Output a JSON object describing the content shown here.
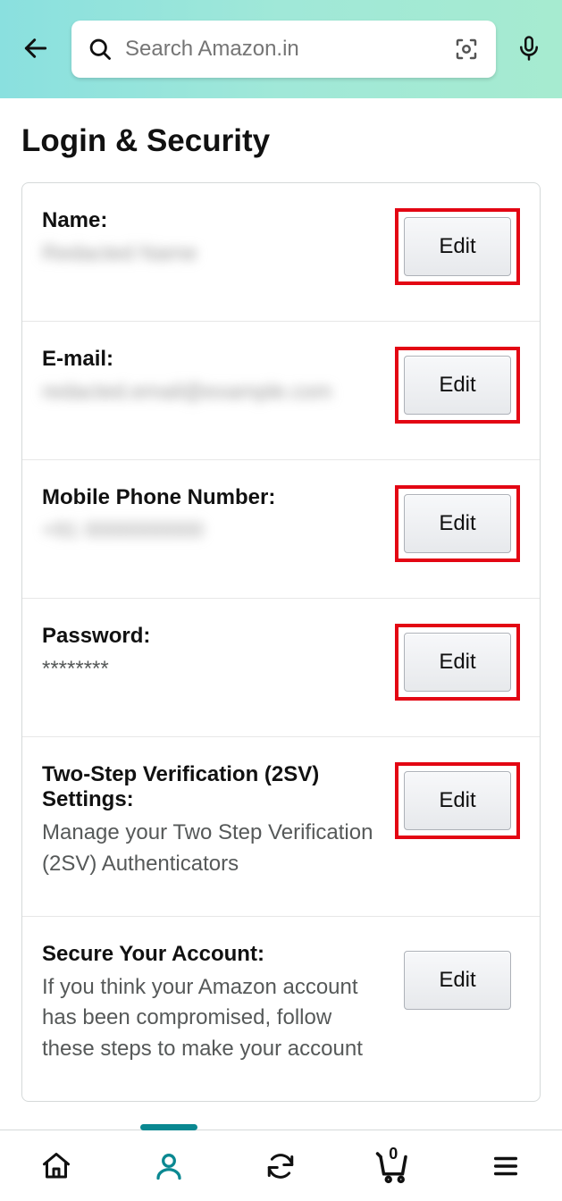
{
  "header": {
    "search_placeholder": "Search Amazon.in"
  },
  "page": {
    "title": "Login & Security"
  },
  "rows": {
    "name": {
      "label": "Name:",
      "value": "Redacted Name",
      "edit": "Edit",
      "blurred": true,
      "highlight": true
    },
    "email": {
      "label": "E-mail:",
      "value": "redacted.email@example.com",
      "edit": "Edit",
      "blurred": true,
      "highlight": true
    },
    "mobile": {
      "label": "Mobile Phone Number:",
      "value": "+91 0000000000",
      "edit": "Edit",
      "blurred": true,
      "highlight": true
    },
    "password": {
      "label": "Password:",
      "value": "********",
      "edit": "Edit",
      "blurred": false,
      "highlight": true
    },
    "twosv": {
      "label": "Two-Step Verification (2SV) Settings:",
      "value": "Manage your Two Step Verification (2SV) Authenticators",
      "edit": "Edit",
      "blurred": false,
      "highlight": true
    },
    "secure": {
      "label": "Secure Your Account:",
      "value": "If you think your Amazon account has been compromised, follow these steps to make your account",
      "edit": "Edit",
      "blurred": false,
      "highlight": false
    }
  },
  "nav": {
    "cart_count": "0"
  }
}
